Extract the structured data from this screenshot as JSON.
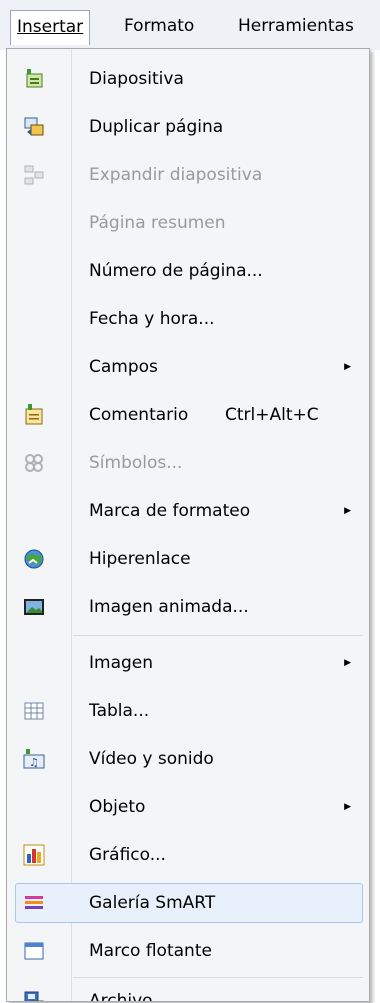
{
  "menubar": {
    "insert": "Insertar",
    "format": "Formato",
    "tools": "Herramientas"
  },
  "menu": {
    "items": [
      {
        "label": "Diapositiva",
        "icon": "new-slide-icon"
      },
      {
        "label": "Duplicar página",
        "icon": "duplicate-page-icon"
      },
      {
        "label": "Expandir diapositiva",
        "icon": "expand-slide-icon",
        "disabled": true
      },
      {
        "label": "Página resumen",
        "disabled": true
      },
      {
        "label": "Número de página..."
      },
      {
        "label": "Fecha y hora..."
      },
      {
        "label": "Campos",
        "submenu": true
      },
      {
        "label": "Comentario",
        "shortcut": "Ctrl+Alt+C",
        "icon": "comment-icon"
      },
      {
        "label": "Símbolos...",
        "icon": "symbols-icon",
        "disabled": true
      },
      {
        "label": "Marca de formateo",
        "submenu": true
      },
      {
        "label": "Hiperenlace",
        "icon": "hyperlink-icon"
      },
      {
        "label": "Imagen animada...",
        "icon": "animated-image-icon"
      },
      {
        "label": "Imagen",
        "submenu": true
      },
      {
        "label": "Tabla...",
        "icon": "table-icon"
      },
      {
        "label": "Vídeo y sonido",
        "icon": "video-sound-icon"
      },
      {
        "label": "Objeto",
        "submenu": true
      },
      {
        "label": "Gráfico...",
        "icon": "chart-icon"
      },
      {
        "label": "Galería SmART",
        "icon": "smart-gallery-icon",
        "hovered": true
      },
      {
        "label": "Marco flotante",
        "icon": "floating-frame-icon"
      },
      {
        "label": "Archivo...",
        "icon": "file-icon"
      }
    ],
    "submenu_arrow": "▶"
  },
  "colors": {
    "menu_background": "#f4f5f7",
    "hover_background": "#e8f1fb",
    "hover_border": "#a9c8ea",
    "disabled_text": "#9a9a9a"
  }
}
